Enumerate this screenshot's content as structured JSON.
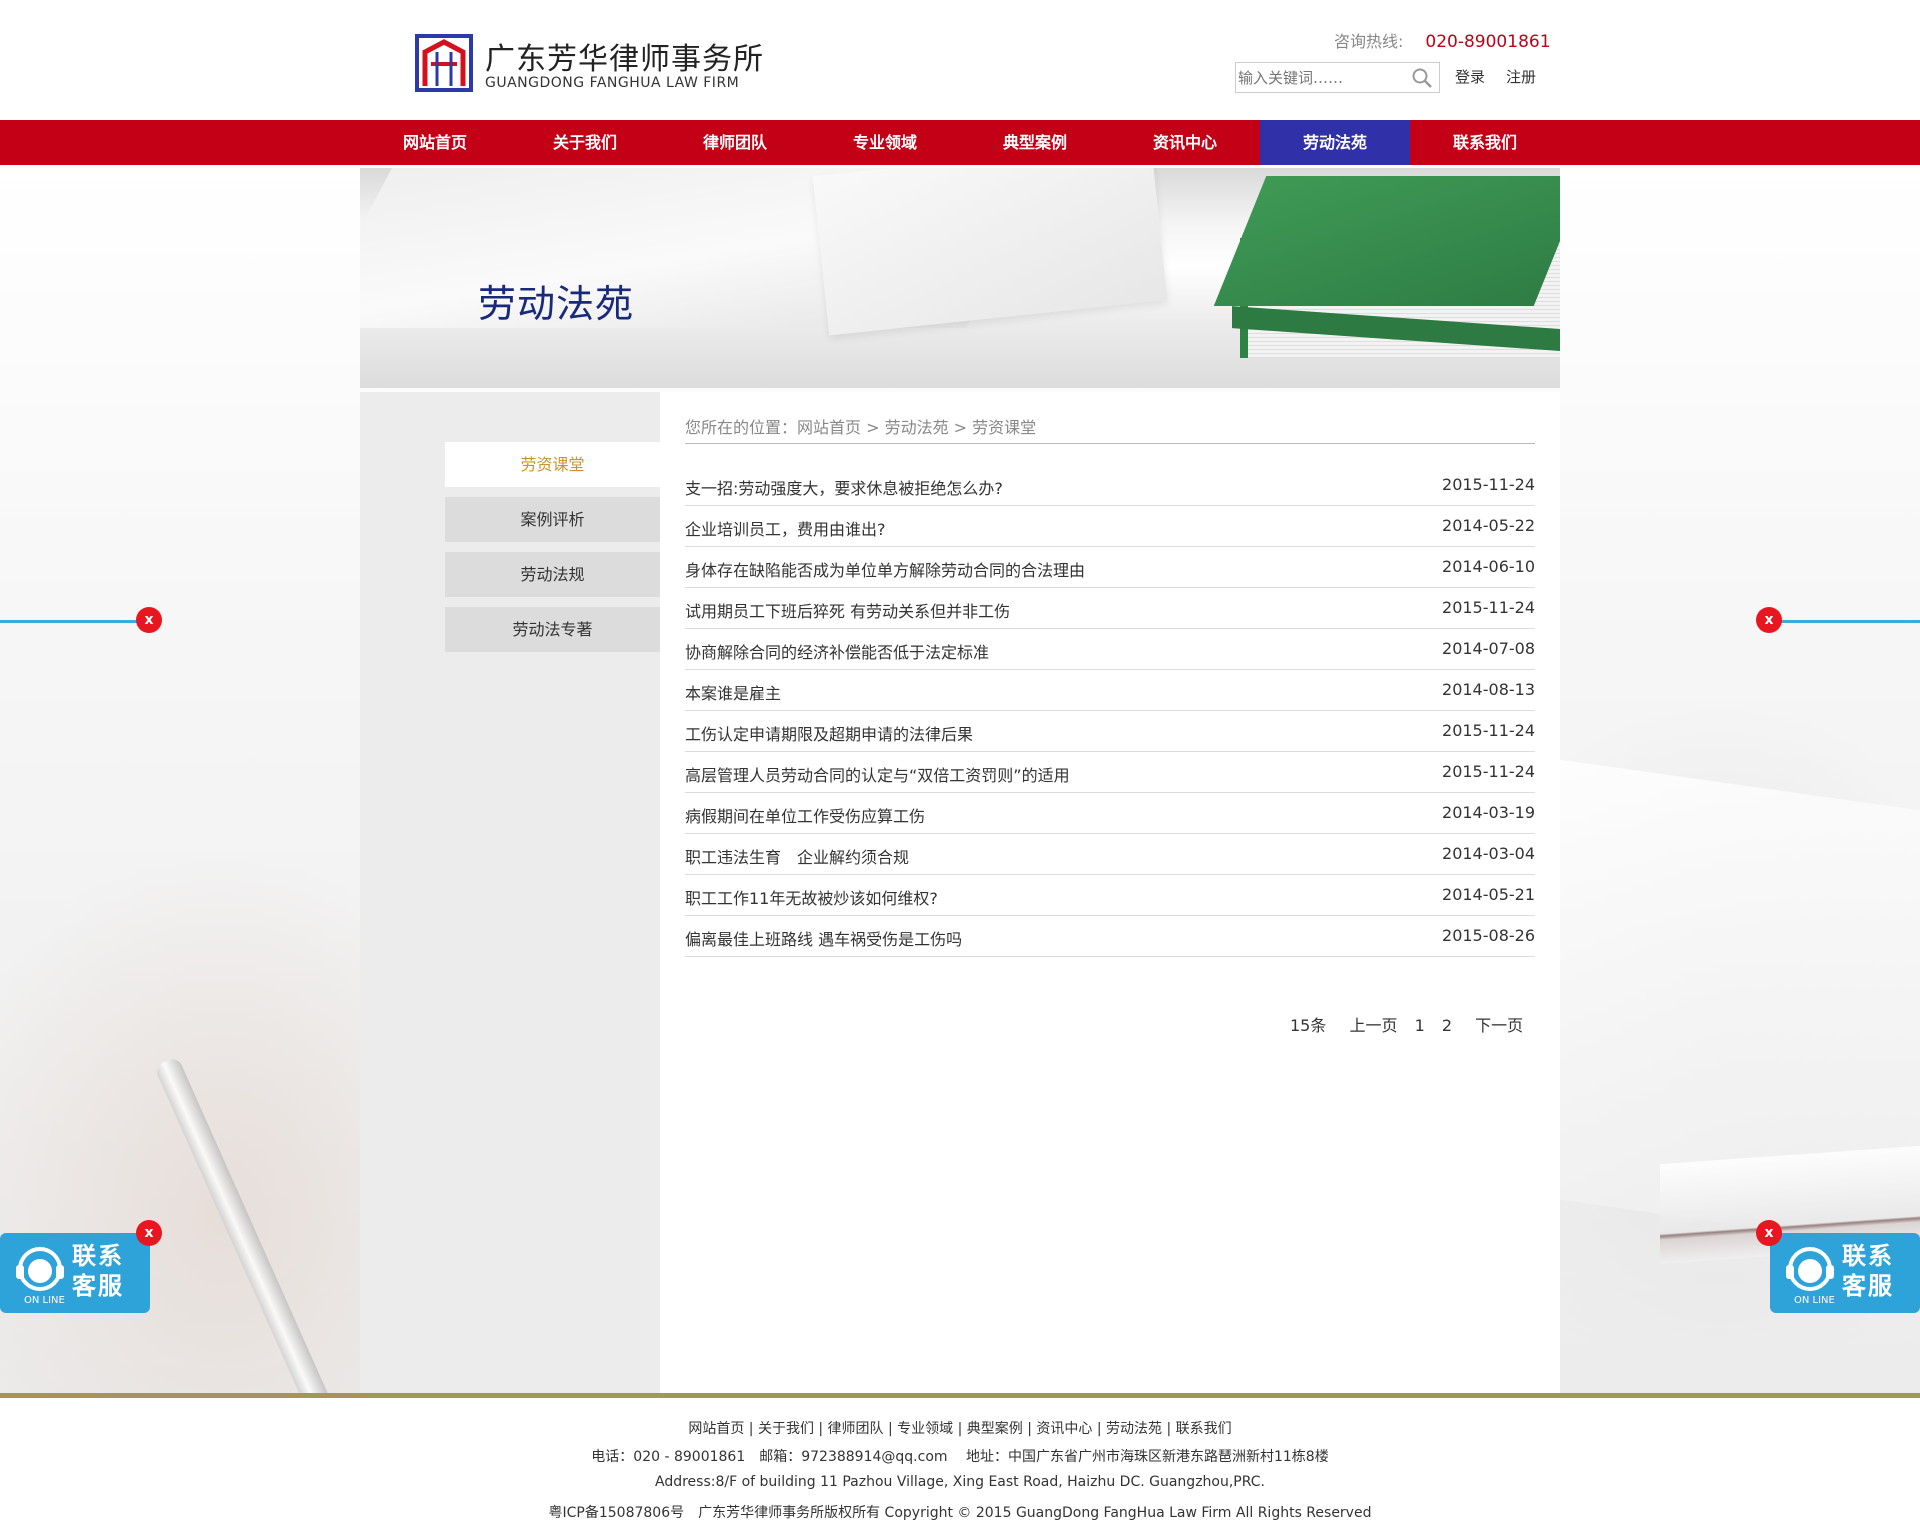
{
  "header": {
    "logo_cn": "广东芳华律师事务所",
    "logo_en": "GUANGDONG FANGHUA LAW  FIRM",
    "hotline_label": "咨询热线:",
    "hotline_number": "020-89001861",
    "search_placeholder": "输入关键词……",
    "login": "登录",
    "register": "注册"
  },
  "nav": {
    "items": [
      "网站首页",
      "关于我们",
      "律师团队",
      "专业领域",
      "典型案例",
      "资讯中心",
      "劳动法苑",
      "联系我们"
    ],
    "active_index": 6
  },
  "banner": {
    "title": "劳动法苑"
  },
  "sidebar": {
    "items": [
      "劳资课堂",
      "案例评析",
      "劳动法规",
      "劳动法专著"
    ],
    "active_index": 0
  },
  "breadcrumb": "您所在的位置：网站首页 > 劳动法苑 > 劳资课堂",
  "articles": [
    {
      "title": "支一招:劳动强度大，要求休息被拒绝怎么办?",
      "date": "2015-11-24"
    },
    {
      "title": "企业培训员工，费用由谁出?",
      "date": "2014-05-22"
    },
    {
      "title": "身体存在缺陷能否成为单位单方解除劳动合同的合法理由",
      "date": "2014-06-10"
    },
    {
      "title": "试用期员工下班后猝死 有劳动关系但并非工伤",
      "date": "2015-11-24"
    },
    {
      "title": "协商解除合同的经济补偿能否低于法定标准",
      "date": "2014-07-08"
    },
    {
      "title": "本案谁是雇主",
      "date": "2014-08-13"
    },
    {
      "title": "工伤认定申请期限及超期申请的法律后果",
      "date": "2015-11-24"
    },
    {
      "title": "高层管理人员劳动合同的认定与“双倍工资罚则”的适用",
      "date": "2015-11-24"
    },
    {
      "title": "病假期间在单位工作受伤应算工伤",
      "date": "2014-03-19"
    },
    {
      "title": "职工违法生育　企业解约须合规",
      "date": "2014-03-04"
    },
    {
      "title": "职工工作11年无故被炒该如何维权?",
      "date": "2014-05-21"
    },
    {
      "title": "偏离最佳上班路线 遇车祸受伤是工伤吗",
      "date": "2015-08-26"
    }
  ],
  "pager": {
    "total": "15条",
    "prev": "上一页",
    "page1": "1",
    "page2": "2",
    "next": "下一页"
  },
  "footer": {
    "links": "网站首页 | 关于我们 | 律师团队 | 专业领域 | 典型案例 | 资讯中心 | 劳动法苑 | 联系我们",
    "contact": "电话：020 - 89001861　邮箱：972388914@qq.com　 地址：中国广东省广州市海珠区新港东路琶洲新村11栋8楼",
    "address_en": "Address:8/F of building 11 Pazhou Village, Xing East Road, Haizhu DC. Guangzhou,PRC.",
    "copyright": "粤ICP备15087806号　广东芳华律师事务所版权所有 Copyright © 2015 GuangDong FangHua Law Firm All Rights Reserved"
  },
  "service_widget": {
    "line1": "联系",
    "line2": "客服",
    "online": "ON LINE",
    "close": "x"
  },
  "colors": {
    "nav_red": "#c30016",
    "nav_active": "#3030a8",
    "accent_gold": "#c8952b",
    "widget_blue": "#2ea3d9"
  }
}
